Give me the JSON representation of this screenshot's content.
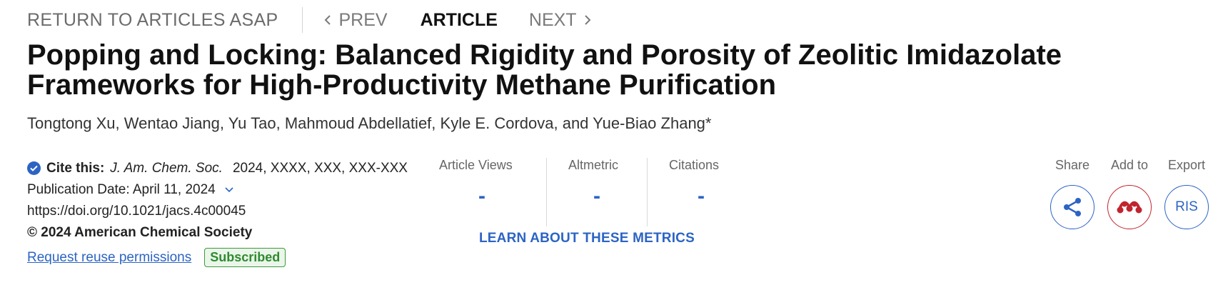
{
  "nav": {
    "return_label": "RETURN TO ARTICLES ASAP",
    "prev_label": "PREV",
    "article_label": "ARTICLE",
    "next_label": "NEXT"
  },
  "article": {
    "title": "Popping and Locking: Balanced Rigidity and Porosity of Zeolitic Imidazolate Frameworks for High-Productivity Methane Purification",
    "authors": "Tongtong Xu, Wentao Jiang, Yu Tao, Mahmoud Abdellatief, Kyle E. Cordova, and Yue-Biao Zhang*"
  },
  "meta": {
    "cite_label": "Cite this:",
    "journal": "J. Am. Chem. Soc.",
    "cite_details": "2024, XXXX, XXX, XXX-XXX",
    "publication_date": "Publication Date: April 11, 2024",
    "doi": "https://doi.org/10.1021/jacs.4c00045",
    "copyright": "© 2024 American Chemical Society",
    "reuse_label": "Request reuse permissions",
    "subscribed_badge": "Subscribed"
  },
  "metrics": {
    "items": [
      {
        "label": "Article Views",
        "value": "-"
      },
      {
        "label": "Altmetric",
        "value": "-"
      },
      {
        "label": "Citations",
        "value": "-"
      }
    ],
    "learn_label": "LEARN ABOUT THESE METRICS"
  },
  "actions": {
    "share_label": "Share",
    "addto_label": "Add to",
    "export_label": "Export",
    "export_button": "RIS"
  },
  "colors": {
    "accent": "#2c64c4",
    "mendeley_red": "#c0252e",
    "subscribed_green": "#2e8b2e"
  },
  "icons": {
    "check": "check-circle-icon",
    "share": "share-icon",
    "mendeley": "mendeley-icon",
    "prev": "chevron-left-icon",
    "next": "chevron-right-icon",
    "date_toggle": "chevron-down-icon"
  }
}
